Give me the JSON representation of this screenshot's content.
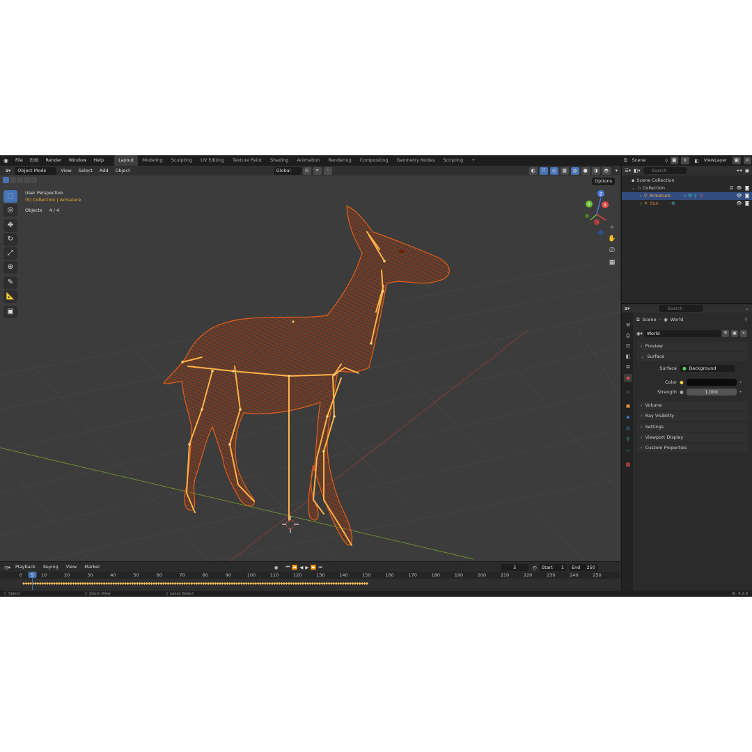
{
  "menu": [
    "File",
    "Edit",
    "Render",
    "Window",
    "Help"
  ],
  "workspaces": [
    "Layout",
    "Modeling",
    "Sculpting",
    "UV Editing",
    "Texture Paint",
    "Shading",
    "Animation",
    "Rendering",
    "Compositing",
    "Geometry Nodes",
    "Scripting"
  ],
  "scene_name": "Scene",
  "view_layer": "ViewLayer",
  "viewport": {
    "mode": "Object Mode",
    "menus": [
      "View",
      "Select",
      "Add",
      "Object"
    ],
    "orientation": "Global",
    "options": "Options",
    "overlay_title": "User Perspective",
    "overlay_collection": "(5) Collection | Armature",
    "objects_label": "Objects",
    "objects_count": "4 / 4",
    "gizmo": {
      "z": "Z",
      "y": "Y",
      "x": "X"
    }
  },
  "timeline": {
    "menus": [
      "Playback",
      "Keying",
      "View",
      "Marker"
    ],
    "current_frame": "5",
    "start_label": "Start",
    "start": "1",
    "end_label": "End",
    "end": "250",
    "ticks": [
      "0",
      "10",
      "20",
      "30",
      "40",
      "50",
      "60",
      "70",
      "80",
      "90",
      "100",
      "110",
      "120",
      "130",
      "140",
      "150",
      "160",
      "170",
      "180",
      "190",
      "200",
      "210",
      "220",
      "230",
      "240",
      "250"
    ],
    "keyframe_fraction": 0.6
  },
  "status": {
    "select": "Select",
    "zoom": "Zoom View",
    "lasso": "Lasso Select",
    "version": "4.2.8"
  },
  "outliner": {
    "search_placeholder": "Search",
    "scene_collection": "Scene Collection",
    "collection": "Collection",
    "items": [
      {
        "name": "Armature",
        "selected": true
      },
      {
        "name": "Sun",
        "selected": false
      }
    ]
  },
  "properties": {
    "search_placeholder": "Search",
    "breadcrumb_scene": "Scene",
    "breadcrumb_world": "World",
    "world_name": "World",
    "sections_top": [
      "Preview",
      "Surface"
    ],
    "surface_label": "Surface",
    "surface_value": "Background",
    "color_label": "Color",
    "strength_label": "Strength",
    "strength_value": "1.000",
    "sections_bottom": [
      "Volume",
      "Ray Visibility",
      "Settings",
      "Viewport Display",
      "Custom Properties"
    ]
  },
  "colors": {
    "accent": "#4772b3",
    "selection": "#ff6a1a",
    "bone": "#ffb347"
  }
}
